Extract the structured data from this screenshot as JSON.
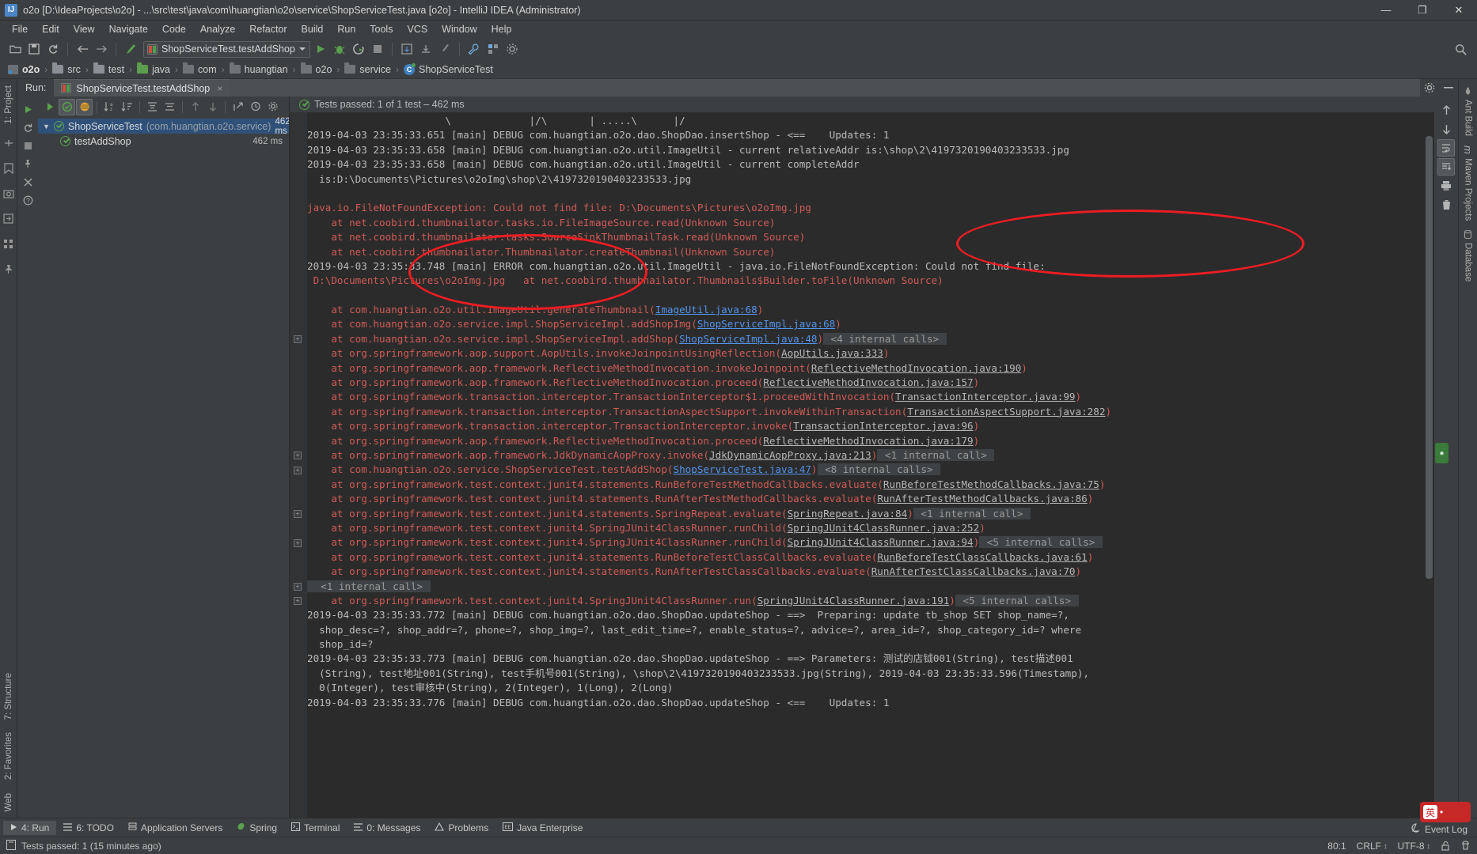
{
  "window": {
    "title": "o2o [D:\\IdeaProjects\\o2o] - ...\\src\\test\\java\\com\\huangtian\\o2o\\service\\ShopServiceTest.java [o2o] - IntelliJ IDEA (Administrator)",
    "app_icon": "IJ",
    "minimize": "—",
    "maximize": "❐",
    "close": "✕"
  },
  "menu": [
    "File",
    "Edit",
    "View",
    "Navigate",
    "Code",
    "Analyze",
    "Refactor",
    "Build",
    "Run",
    "Tools",
    "VCS",
    "Window",
    "Help"
  ],
  "toolbar": {
    "run_config": "ShopServiceTest.testAddShop",
    "icons": [
      "open-icon",
      "save-icon",
      "sync-icon",
      "back-icon",
      "forward-icon",
      "build-icon"
    ],
    "run_icons": [
      "run-icon",
      "debug-icon",
      "run-coverage-icon",
      "stop-icon"
    ],
    "right_icons": [
      "search-everywhere-icon"
    ]
  },
  "breadcrumb": [
    {
      "label": "o2o",
      "icon": "module-icon",
      "bold": true
    },
    {
      "label": "src",
      "icon": "folder-icon"
    },
    {
      "label": "test",
      "icon": "folder-icon"
    },
    {
      "label": "java",
      "icon": "source-folder-icon"
    },
    {
      "label": "com",
      "icon": "package-icon"
    },
    {
      "label": "huangtian",
      "icon": "package-icon"
    },
    {
      "label": "o2o",
      "icon": "package-icon"
    },
    {
      "label": "service",
      "icon": "package-icon"
    },
    {
      "label": "ShopServiceTest",
      "icon": "test-class-icon"
    }
  ],
  "left_rail": {
    "project_tab": "1: Project",
    "structure_tab": "7: Structure",
    "favorites_tab": "2: Favorites",
    "web_tab": "Web"
  },
  "right_rail": [
    {
      "label": "Ant Build",
      "icon": "ant-icon"
    },
    {
      "label": "Maven Projects",
      "icon": "maven-icon"
    },
    {
      "label": "Database",
      "icon": "database-icon"
    }
  ],
  "run_window": {
    "label": "Run:",
    "tab": "ShopServiceTest.testAddShop",
    "close_x": "×",
    "gear_icon": "gear-icon",
    "minimize_icon": "minimize-icon"
  },
  "test_tree": {
    "status": "Tests passed: 1 of 1 test – 462 ms",
    "nodes": [
      {
        "name": "ShopServiceTest",
        "pkg": "(com.huangtian.o2o.service)",
        "time": "462 ms",
        "selected": true,
        "arrow": "▼"
      },
      {
        "name": "testAddShop",
        "pkg": "",
        "time": "462 ms",
        "selected": false,
        "arrow": ""
      }
    ]
  },
  "console": {
    "lines": [
      {
        "type": "cut",
        "text": "                       \\             |/\\       | .....\\      |/"
      },
      {
        "type": "log",
        "text": "2019-04-03 23:35:33.651 [main] DEBUG com.huangtian.o2o.dao.ShopDao.insertShop - <==    Updates: 1"
      },
      {
        "type": "log",
        "text": "2019-04-03 23:35:33.658 [main] DEBUG com.huangtian.o2o.util.ImageUtil - current relativeAddr is:\\shop\\2\\4197320190403233533.jpg"
      },
      {
        "type": "log",
        "text": "2019-04-03 23:35:33.658 [main] DEBUG com.huangtian.o2o.util.ImageUtil - current completeAddr"
      },
      {
        "type": "log",
        "text": "  is:D:\\Documents\\Pictures\\o2oImg\\shop\\2\\4197320190403233533.jpg"
      },
      {
        "type": "blank",
        "text": ""
      },
      {
        "type": "err",
        "text": "java.io.FileNotFoundException: Could not find file: D:\\Documents\\Pictures\\o2oImg.jpg"
      },
      {
        "type": "err",
        "text": "    at net.coobird.thumbnailator.tasks.io.FileImageSource.read(Unknown Source)"
      },
      {
        "type": "err",
        "text": "    at net.coobird.thumbnailator.tasks.SourceSinkThumbnailTask.read(Unknown Source)"
      },
      {
        "type": "err",
        "text": "    at net.coobird.thumbnailator.Thumbnailator.createThumbnail(Unknown Source)"
      },
      {
        "type": "log",
        "text": "2019-04-03 23:35:33.748 [main] ERROR com.huangtian.o2o.util.ImageUtil - java.io.FileNotFoundException: Could not find file:"
      },
      {
        "type": "err2",
        "text": " D:\\Documents\\Pictures\\o2oImg.jpg   at net.coobird.thumbnailator.Thumbnails$Builder.toFile(Unknown Source)"
      },
      {
        "type": "blank",
        "text": ""
      },
      {
        "type": "trace",
        "prefix": "    at com.huangtian.o2o.util.ImageUtil.generateThumbnail(",
        "link": "ImageUtil.java:68",
        "suffix": ")",
        "tail": ""
      },
      {
        "type": "trace",
        "prefix": "    at com.huangtian.o2o.service.impl.ShopServiceImpl.addShopImg(",
        "link": "ShopServiceImpl.java:68",
        "suffix": ")",
        "tail": ""
      },
      {
        "type": "trace",
        "fold": true,
        "prefix": "    at com.huangtian.o2o.service.impl.ShopServiceImpl.addShop(",
        "link": "ShopServiceImpl.java:48",
        "suffix": ")",
        "tail": "<4 internal calls>"
      },
      {
        "type": "trace",
        "prefix": "    at org.springframework.aop.support.AopUtils.invokeJoinpointUsingReflection(",
        "link": "AopUtils.java:333",
        "linkgray": true,
        "suffix": ")",
        "tail": ""
      },
      {
        "type": "trace",
        "prefix": "    at org.springframework.aop.framework.ReflectiveMethodInvocation.invokeJoinpoint(",
        "link": "ReflectiveMethodInvocation.java:190",
        "linkgray": true,
        "suffix": ")",
        "tail": ""
      },
      {
        "type": "trace",
        "prefix": "    at org.springframework.aop.framework.ReflectiveMethodInvocation.proceed(",
        "link": "ReflectiveMethodInvocation.java:157",
        "linkgray": true,
        "suffix": ")",
        "tail": ""
      },
      {
        "type": "trace",
        "prefix": "    at org.springframework.transaction.interceptor.TransactionInterceptor$1.proceedWithInvocation(",
        "link": "TransactionInterceptor.java:99",
        "linkgray": true,
        "suffix": ")",
        "tail": ""
      },
      {
        "type": "trace",
        "prefix": "    at org.springframework.transaction.interceptor.TransactionAspectSupport.invokeWithinTransaction(",
        "link": "TransactionAspectSupport.java:282",
        "linkgray": true,
        "suffix": ")",
        "tail": ""
      },
      {
        "type": "trace",
        "prefix": "    at org.springframework.transaction.interceptor.TransactionInterceptor.invoke(",
        "link": "TransactionInterceptor.java:96",
        "linkgray": true,
        "suffix": ")",
        "tail": ""
      },
      {
        "type": "trace",
        "prefix": "    at org.springframework.aop.framework.ReflectiveMethodInvocation.proceed(",
        "link": "ReflectiveMethodInvocation.java:179",
        "linkgray": true,
        "suffix": ")",
        "tail": ""
      },
      {
        "type": "trace",
        "fold": true,
        "prefix": "    at org.springframework.aop.framework.JdkDynamicAopProxy.invoke(",
        "link": "JdkDynamicAopProxy.java:213",
        "linkgray": true,
        "suffix": ")",
        "tail": "<1 internal call>"
      },
      {
        "type": "trace",
        "fold": true,
        "prefix": "    at com.huangtian.o2o.service.ShopServiceTest.testAddShop(",
        "link": "ShopServiceTest.java:47",
        "suffix": ")",
        "tail": "<8 internal calls>"
      },
      {
        "type": "trace",
        "prefix": "    at org.springframework.test.context.junit4.statements.RunBeforeTestMethodCallbacks.evaluate(",
        "link": "RunBeforeTestMethodCallbacks.java:75",
        "linkgray": true,
        "suffix": ")",
        "tail": ""
      },
      {
        "type": "trace",
        "prefix": "    at org.springframework.test.context.junit4.statements.RunAfterTestMethodCallbacks.evaluate(",
        "link": "RunAfterTestMethodCallbacks.java:86",
        "linkgray": true,
        "suffix": ")",
        "tail": ""
      },
      {
        "type": "trace",
        "fold": true,
        "prefix": "    at org.springframework.test.context.junit4.statements.SpringRepeat.evaluate(",
        "link": "SpringRepeat.java:84",
        "linkgray": true,
        "suffix": ")",
        "tail": "<1 internal call>"
      },
      {
        "type": "trace",
        "prefix": "    at org.springframework.test.context.junit4.SpringJUnit4ClassRunner.runChild(",
        "link": "SpringJUnit4ClassRunner.java:252",
        "linkgray": true,
        "suffix": ")",
        "tail": ""
      },
      {
        "type": "trace",
        "fold": true,
        "prefix": "    at org.springframework.test.context.junit4.SpringJUnit4ClassRunner.runChild(",
        "link": "SpringJUnit4ClassRunner.java:94",
        "linkgray": true,
        "suffix": ")",
        "tail": "<5 internal calls>"
      },
      {
        "type": "trace",
        "prefix": "    at org.springframework.test.context.junit4.statements.RunBeforeTestClassCallbacks.evaluate(",
        "link": "RunBeforeTestClassCallbacks.java:61",
        "linkgray": true,
        "suffix": ")",
        "tail": ""
      },
      {
        "type": "trace",
        "prefix": "    at org.springframework.test.context.junit4.statements.RunAfterTestClassCallbacks.evaluate(",
        "link": "RunAfterTestClassCallbacks.java:70",
        "linkgray": true,
        "suffix": ")",
        "tail": ""
      },
      {
        "type": "foldline",
        "fold": true,
        "text": "<1 internal call>"
      },
      {
        "type": "trace",
        "fold": true,
        "prefix": "    at org.springframework.test.context.junit4.SpringJUnit4ClassRunner.run(",
        "link": "SpringJUnit4ClassRunner.java:191",
        "linkgray": true,
        "suffix": ")",
        "tail": "<5 internal calls>"
      },
      {
        "type": "log",
        "text": "2019-04-03 23:35:33.772 [main] DEBUG com.huangtian.o2o.dao.ShopDao.updateShop - ==>  Preparing: update tb_shop SET shop_name=?,"
      },
      {
        "type": "log",
        "text": "  shop_desc=?, shop_addr=?, phone=?, shop_img=?, last_edit_time=?, enable_status=?, advice=?, area_id=?, shop_category_id=? where"
      },
      {
        "type": "log",
        "text": "  shop_id=?"
      },
      {
        "type": "log",
        "text": "2019-04-03 23:35:33.773 [main] DEBUG com.huangtian.o2o.dao.ShopDao.updateShop - ==> Parameters: 测试的店钺001(String), test描述001"
      },
      {
        "type": "log",
        "text": "  (String), test地址001(String), test手机号001(String), \\shop\\2\\4197320190403233533.jpg(String), 2019-04-03 23:35:33.596(Timestamp),"
      },
      {
        "type": "log",
        "text": "  0(Integer), test审核中(String), 2(Integer), 1(Long), 2(Long)"
      },
      {
        "type": "log",
        "text": "2019-04-03 23:35:33.776 [main] DEBUG com.huangtian.o2o.dao.ShopDao.updateShop - <==    Updates: 1"
      }
    ]
  },
  "toolwindows": [
    {
      "label": "4: Run",
      "num": "4",
      "icon": "run-icon",
      "active": true
    },
    {
      "label": "6: TODO",
      "num": "6",
      "icon": "todo-icon",
      "active": false
    },
    {
      "label": "Application Servers",
      "icon": "servers-icon",
      "active": false
    },
    {
      "label": "Spring",
      "icon": "spring-icon",
      "active": false
    },
    {
      "label": "Terminal",
      "icon": "terminal-icon",
      "active": false
    },
    {
      "label": "0: Messages",
      "num": "0",
      "icon": "messages-icon",
      "active": false
    },
    {
      "label": "Problems",
      "icon": "warning-icon",
      "active": false
    },
    {
      "label": "Java Enterprise",
      "icon": "java-ee-icon",
      "active": false
    }
  ],
  "statusbar": {
    "message": "Tests passed: 1 (15 minutes ago)",
    "event_log": "Event Log",
    "position": "80:1",
    "line_sep": "CRLF",
    "encoding": "UTF-8",
    "lock_icon": "unlocked-icon",
    "inspections_icon": "hector-icon"
  },
  "ime_badge": {
    "letter": "英",
    "mark": "•"
  },
  "colors": {
    "accent_blue": "#5394ec",
    "error_red": "#cf5b56",
    "annotation_red": "#ee1c23",
    "pass_green": "#5aa04f",
    "console_bg": "#2b2b2b",
    "chrome_bg": "#3c3f41"
  }
}
